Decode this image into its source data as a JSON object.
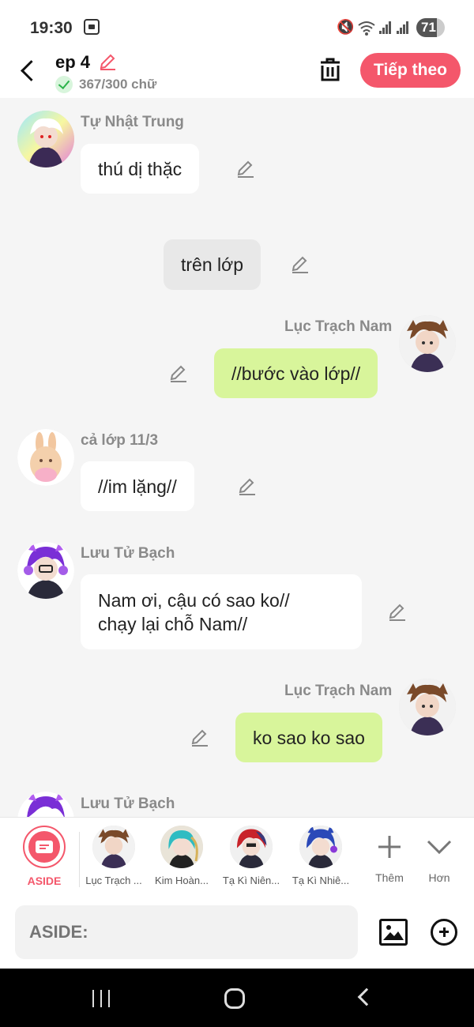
{
  "status_bar": {
    "time": "19:30",
    "battery": "71"
  },
  "header": {
    "title": "ep 4",
    "word_count": "367/300 chữ",
    "next_button": "Tiếp theo"
  },
  "messages": [
    {
      "speaker": "Tự Nhật Trung",
      "text": "thú dị thặc",
      "side": "left"
    },
    {
      "speaker": "",
      "text": "trên lớp",
      "side": "narration"
    },
    {
      "speaker": "Lục Trạch Nam",
      "text": "//bước vào lớp//",
      "side": "right"
    },
    {
      "speaker": "cả lớp 11/3",
      "text": "//im lặng//",
      "side": "left"
    },
    {
      "speaker": "Lưu Tử Bạch",
      "text": "Nam ơi, cậu có sao ko//\nchạy lại chỗ Nam//",
      "side": "left"
    },
    {
      "speaker": "Lục Trạch Nam",
      "text": "ko sao ko sao",
      "side": "right"
    },
    {
      "speaker": "Lưu Tử Bạch",
      "text": "",
      "side": "left"
    }
  ],
  "character_bar": {
    "items": [
      {
        "label": "ASIDE"
      },
      {
        "label": "Lục Trạch ..."
      },
      {
        "label": "Kim Hoàn..."
      },
      {
        "label": "Tạ Kì Niên..."
      },
      {
        "label": "Tạ Kì Nhiê..."
      }
    ],
    "add_label": "Thêm",
    "more_label": "Hơn"
  },
  "input": {
    "placeholder": "ASIDE:"
  },
  "colors": {
    "accent": "#f4576b",
    "right_bubble": "#d8f59b",
    "narration_bubble": "#e8e8e8"
  }
}
